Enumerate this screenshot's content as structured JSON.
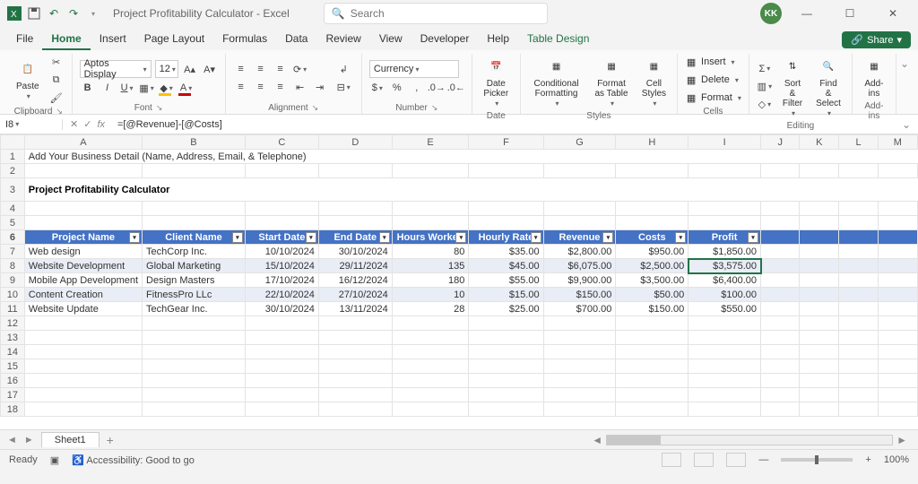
{
  "titlebar": {
    "title": "Project Profitability Calculator - Excel",
    "search_placeholder": "Search",
    "avatar_initials": "KK"
  },
  "menu": {
    "tabs": [
      "File",
      "Home",
      "Insert",
      "Page Layout",
      "Formulas",
      "Data",
      "Review",
      "View",
      "Developer",
      "Help",
      "Table Design"
    ],
    "active_index": 1,
    "contextual_index": 10,
    "share": "Share"
  },
  "ribbon": {
    "clipboard": {
      "label": "Clipboard",
      "paste": "Paste"
    },
    "font": {
      "label": "Font",
      "family": "Aptos Display",
      "size": "12"
    },
    "alignment": {
      "label": "Alignment"
    },
    "number": {
      "label": "Number",
      "format": "Currency"
    },
    "date": {
      "label": "Date",
      "picker": "Date Picker"
    },
    "styles": {
      "label": "Styles",
      "cond": "Conditional Formatting",
      "fat": "Format as Table",
      "cell": "Cell Styles"
    },
    "cells": {
      "label": "Cells",
      "insert": "Insert",
      "delete": "Delete",
      "format": "Format"
    },
    "editing": {
      "label": "Editing",
      "sort": "Sort & Filter",
      "find": "Find & Select"
    },
    "addins": {
      "label": "Add-ins",
      "addins": "Add-ins"
    }
  },
  "formula": {
    "cellref": "I8",
    "text": "=[@Revenue]-[@Costs]"
  },
  "sheet": {
    "columns": [
      "A",
      "B",
      "C",
      "D",
      "E",
      "F",
      "G",
      "H",
      "I",
      "J",
      "K",
      "L",
      "M"
    ],
    "row1": "Add Your Business Detail (Name, Address, Email, & Telephone)",
    "title": "Project Profitability Calculator",
    "headers": [
      "Project Name",
      "Client Name",
      "Start Date",
      "End Date",
      "Hours Worked",
      "Hourly Rate",
      "Revenue",
      "Costs",
      "Profit"
    ],
    "rows": [
      {
        "n": "7",
        "d": [
          "Web design",
          "TechCorp Inc.",
          "10/10/2024",
          "30/10/2024",
          "80",
          "$35.00",
          "$2,800.00",
          "$950.00",
          "$1,850.00"
        ]
      },
      {
        "n": "8",
        "d": [
          "Website Development",
          "Global Marketing",
          "15/10/2024",
          "29/11/2024",
          "135",
          "$45.00",
          "$6,075.00",
          "$2,500.00",
          "$3,575.00"
        ]
      },
      {
        "n": "9",
        "d": [
          "Mobile App Development",
          "Design Masters",
          "17/10/2024",
          "16/12/2024",
          "180",
          "$55.00",
          "$9,900.00",
          "$3,500.00",
          "$6,400.00"
        ]
      },
      {
        "n": "10",
        "d": [
          "Content Creation",
          "FitnessPro LLc",
          "22/10/2024",
          "27/10/2024",
          "10",
          "$15.00",
          "$150.00",
          "$50.00",
          "$100.00"
        ]
      },
      {
        "n": "11",
        "d": [
          "Website Update",
          "TechGear Inc.",
          "30/10/2024",
          "13/11/2024",
          "28",
          "$25.00",
          "$700.00",
          "$150.00",
          "$550.00"
        ]
      }
    ],
    "empty_rows": [
      "12",
      "13",
      "14",
      "15",
      "16",
      "17",
      "18"
    ]
  },
  "sheettabs": {
    "name": "Sheet1"
  },
  "status": {
    "ready": "Ready",
    "accessibility": "Accessibility: Good to go",
    "zoom": "100%"
  }
}
